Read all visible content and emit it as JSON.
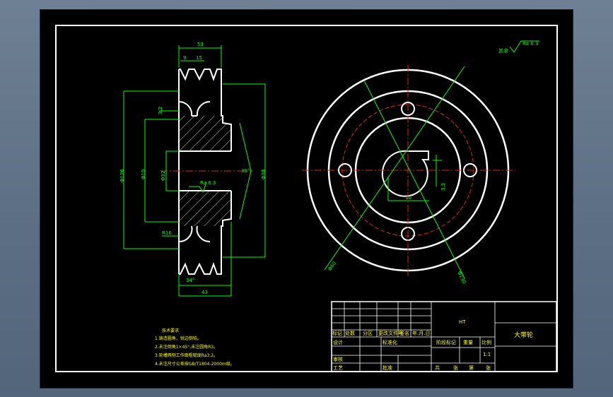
{
  "drawing": {
    "roughness_note": "其余",
    "roughness_value": "Ra 6.3",
    "bore_roughness": "Ra 6.3",
    "dims": {
      "top_width": "53",
      "groove_pitch_a": "9",
      "groove_pitch_b": "15",
      "groove_depth": "3.2",
      "outer_diameter": "Φ126",
      "pitch_diameter": "Φ10",
      "bore": "Φ32",
      "hub_angle": "30°",
      "hub_diameter": "Φ38",
      "side_note": "R16",
      "groove_angle": "34°",
      "bottom_width": "43",
      "keyway_width": "10",
      "keyway_depth": "3.3",
      "hole_circle": "Φ60",
      "outer_circle_dia": "Φ130"
    },
    "tech_requirements": {
      "title": "技术要求",
      "lines": [
        "1.铸造圆角，锐边倒钝。",
        "2.未注倒角1×45°,未注圆角R3。",
        "3.轮槽两侧工作面粗糙度Ra3.2。",
        "4.未注尺寸公差按GB/T1804-2000m级。"
      ]
    }
  },
  "title_block": {
    "material": "HT",
    "part_name": "大带轮",
    "row_labels": [
      "标记",
      "处数",
      "分区",
      "更改文件号",
      "签名",
      "年.月.日"
    ],
    "design": "设计",
    "standardize": "标准化",
    "review": "审核",
    "process": "工艺",
    "approve": "批准",
    "stage_label": "阶段标记",
    "weight_label": "重量",
    "scale_label": "比例",
    "scale_value": "1:1",
    "sheet_info": [
      "共",
      "张",
      "第",
      "张"
    ]
  }
}
